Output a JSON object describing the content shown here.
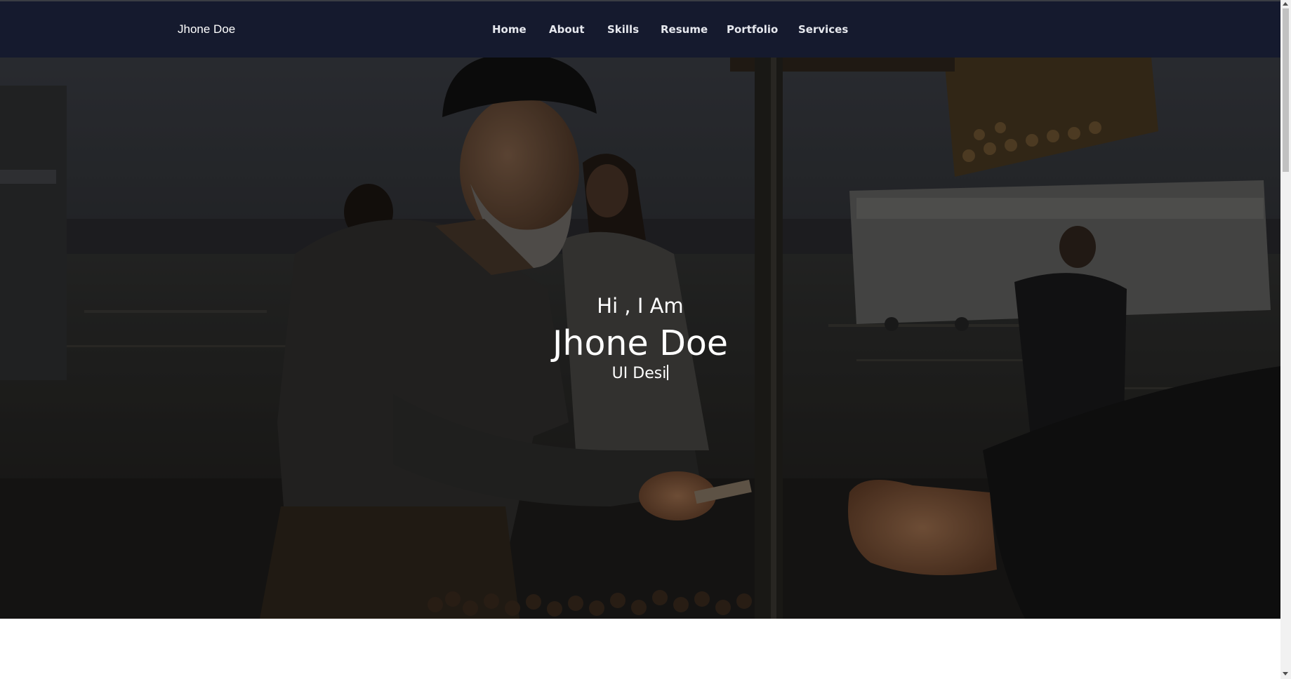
{
  "nav": {
    "brand": "Jhone Doe",
    "links": [
      "Home",
      "About",
      "Skills",
      "Resume",
      "Portfolio",
      "Services"
    ]
  },
  "hero": {
    "greeting": "Hi , I Am",
    "name": "Jhone Doe",
    "role_typed": "UI Desi",
    "background_image": "street vendor selling roasted chestnuts by the waterfront"
  },
  "colors": {
    "navbar": "#151a2e",
    "overlay": "#000000",
    "text": "#ffffff"
  }
}
